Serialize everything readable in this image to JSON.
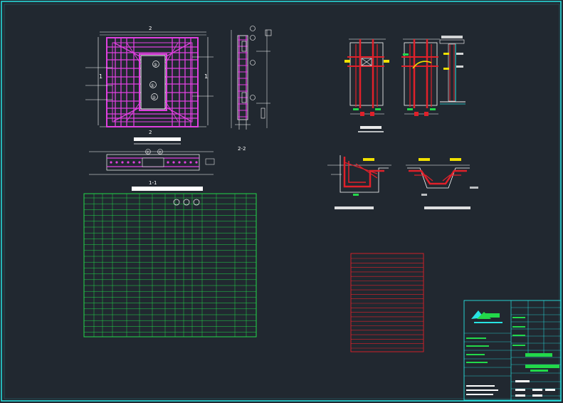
{
  "sheet": {
    "section_2_2_label": "2-2",
    "section_1_1_label": "1-1",
    "mark_1_left": "1",
    "mark_1_right": "1",
    "mark_2_top": "2",
    "mark_2_bottom": "2",
    "callouts_plan": [
      "③",
      "①",
      "②"
    ],
    "callouts_section": [
      "①",
      "②"
    ],
    "callouts_table": [
      "①",
      "②",
      "③"
    ],
    "beam_tag": "TX",
    "node_tags": [
      "TC",
      "TB"
    ]
  },
  "colors": {
    "background": "#212830",
    "frame": "#28e3e3",
    "magenta": "#e040e0",
    "white": "#ffffff",
    "green": "#22d84a",
    "red": "#e0202a",
    "yellow": "#f0e000"
  },
  "title_block": {
    "logo": "logo-icon"
  }
}
